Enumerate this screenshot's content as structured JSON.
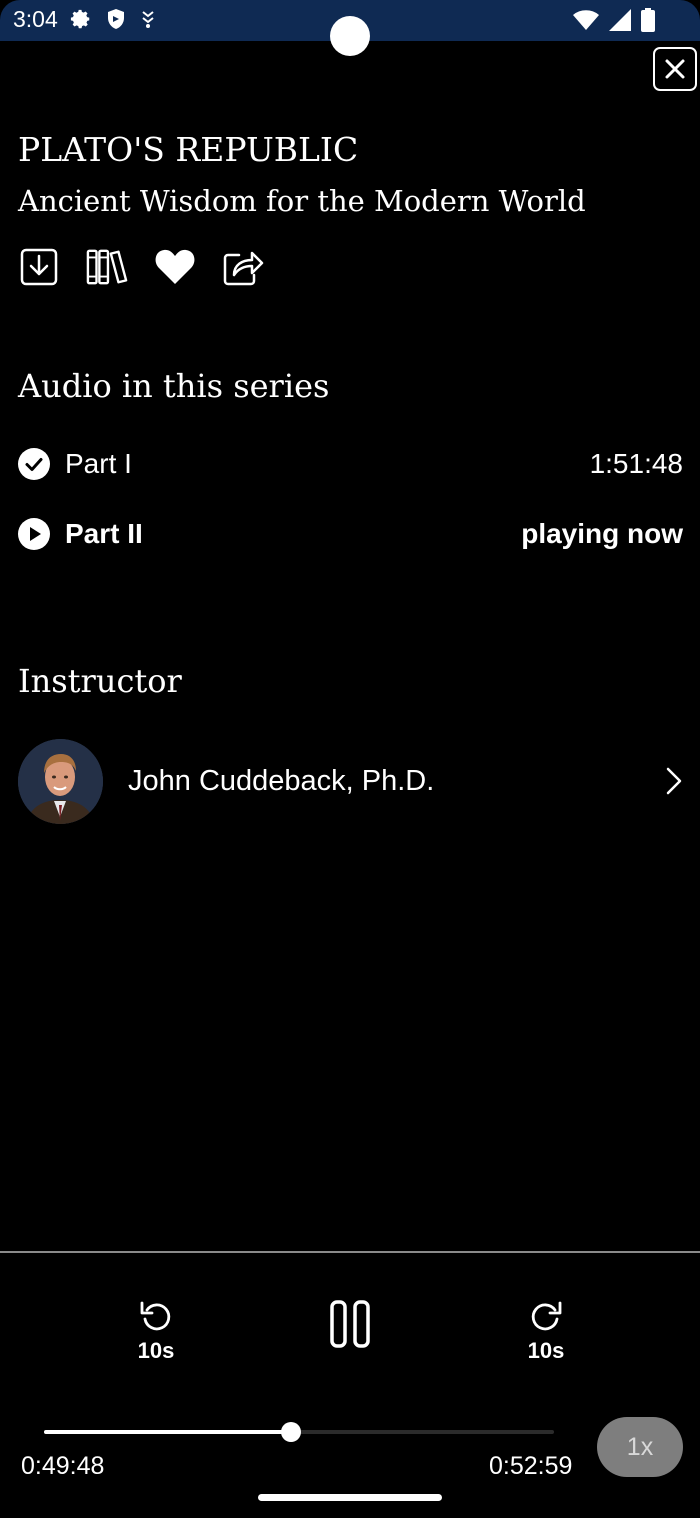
{
  "status_bar": {
    "time": "3:04",
    "icons": [
      "gear-icon",
      "shield-icon",
      "download-arrow-icon",
      "wifi-icon",
      "signal-icon",
      "battery-icon"
    ]
  },
  "header": {
    "close_icon": "close-icon"
  },
  "course": {
    "title": "PLATO'S REPUBLIC",
    "subtitle": "Ancient Wisdom for the Modern World",
    "actions": [
      "download-icon",
      "library-icon",
      "heart-icon",
      "share-icon"
    ]
  },
  "series": {
    "heading": "Audio in this series",
    "items": [
      {
        "label": "Part I",
        "meta": "1:51:48",
        "icon": "check-circle-icon"
      },
      {
        "label": "Part II",
        "meta": "playing now",
        "icon": "play-circle-icon"
      }
    ]
  },
  "instructor": {
    "heading": "Instructor",
    "name": "John Cuddeback, Ph.D."
  },
  "player": {
    "rewind_label": "10s",
    "forward_label": "10s",
    "elapsed": "0:49:48",
    "remaining": "0:52:59",
    "progress_fraction": 0.485,
    "speed": "1x",
    "state": "playing"
  },
  "colors": {
    "status_bar": "#0f2a53",
    "background": "#000000",
    "speed_button": "#7e7e7e"
  }
}
